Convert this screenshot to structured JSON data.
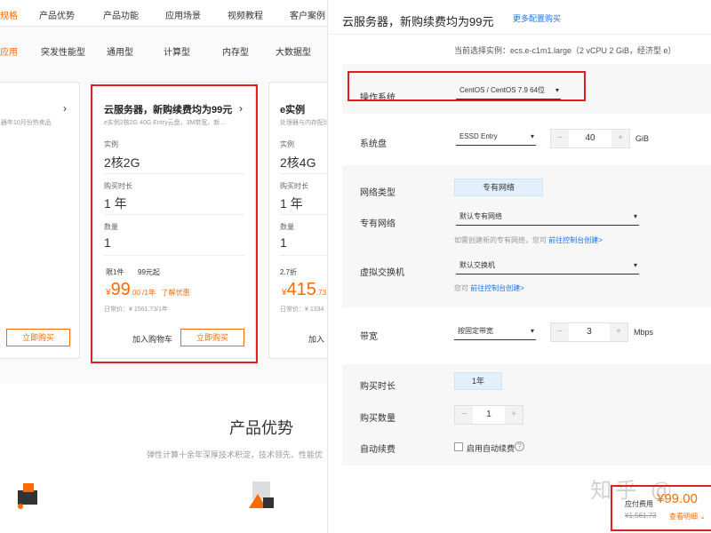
{
  "left": {
    "nav_tabs": [
      "规格",
      "产品优势",
      "产品功能",
      "应用场景",
      "视频教程",
      "客户案例"
    ],
    "sub_tabs": [
      "应用",
      "突发性能型",
      "通用型",
      "计算型",
      "内存型",
      "大数据型"
    ],
    "card_left": {
      "subtitle": "器年10月份热卖品",
      "buy": "立即购买"
    },
    "card_mid": {
      "title": "云服务器，新购续费均为99元",
      "subtitle": "e实例2核2G 40G Entry云盘，3M带宽，新...",
      "instance_label": "实例",
      "instance_value": "2核2G",
      "duration_label": "购买时长",
      "duration_value": "1 年",
      "qty_label": "数量",
      "qty_value": "1",
      "limit": "限1件",
      "promo": "99元起",
      "price_symbol": "¥",
      "price_big": "99",
      "price_rest": ".00 /1年",
      "discount_link": "了解优惠",
      "daily": "日常价：¥ 1561.73/1年",
      "cart": "加入购物车",
      "buy": "立即购买"
    },
    "card_right": {
      "title": "e实例",
      "subtitle": "处理器与内存配比为1:2",
      "instance_label": "实例",
      "instance_value": "2核4G",
      "duration_label": "购买时长",
      "duration_value": "1 年",
      "qty_label": "数量",
      "qty_value": "1",
      "discount": "2.7折",
      "price_symbol": "¥",
      "price_big": "415",
      "price_rest": ".73",
      "daily": "日常价：¥ 1334",
      "cart": "加入"
    },
    "advantages_title": "产品优势",
    "advantages_sub": "弹性计算十余年深厚技术积淀，技术领先、性能优"
  },
  "modal": {
    "title": "云服务器，新购续费均为99元",
    "more_link": "更多配置购买",
    "current_instance": "当前选择实例：ecs.e-c1m1.large（2 vCPU 2 GiB，经济型 e）",
    "os_label": "操作系统",
    "os_value": "CentOS / CentOS 7.9 64位",
    "disk_label": "系统盘",
    "disk_type": "ESSD Entry",
    "disk_size": "40",
    "disk_unit": "GiB",
    "net_type_label": "网络类型",
    "net_type_value": "专有网络",
    "vpc_label": "专有网络",
    "vpc_value": "默认专有网络",
    "vpc_hint": "如需创建新的专有网络，您可",
    "vpc_hint_link": "前往控制台创建>",
    "vswitch_label": "虚拟交换机",
    "vswitch_value": "默认交换机",
    "vswitch_hint": "您可",
    "vswitch_hint_link": "前往控制台创建>",
    "bw_label": "带宽",
    "bw_type": "按固定带宽",
    "bw_value": "3",
    "bw_unit": "Mbps",
    "duration_label": "购买时长",
    "duration_value": "1年",
    "qty_label": "购买数量",
    "qty_value": "1",
    "renew_label": "自动续费",
    "renew_option": "启用自动续费",
    "price_label": "应付费用",
    "price_value": "¥99.00",
    "price_old": "¥1,561.73",
    "detail_link": "查看明细",
    "watermark": "知乎 @"
  }
}
